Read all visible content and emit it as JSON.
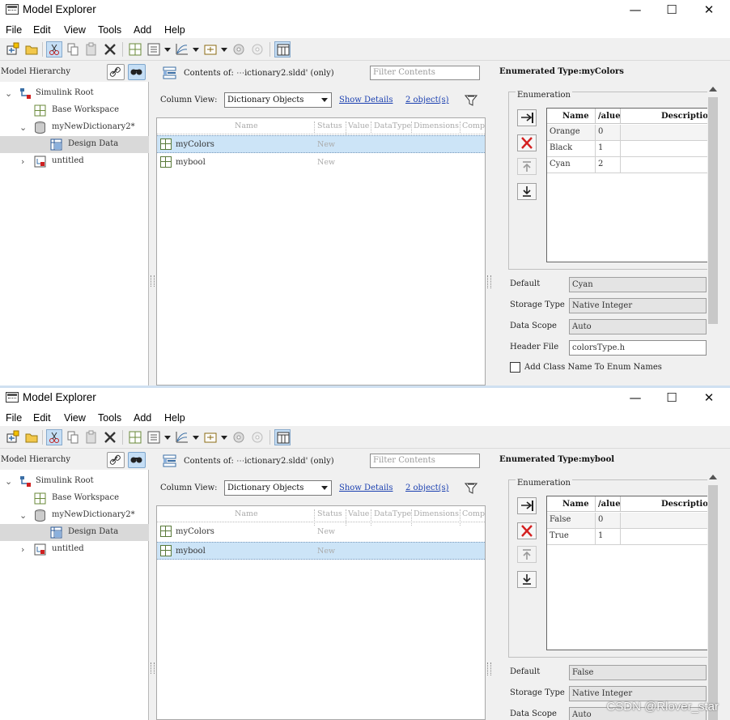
{
  "app": {
    "title": "Model Explorer",
    "window_buttons": {
      "minimize": "—",
      "maximize": "☐",
      "close": "✕"
    }
  },
  "menu": [
    "File",
    "Edit",
    "View",
    "Tools",
    "Add",
    "Help"
  ],
  "toolbar_icons": [
    "new-object-icon",
    "open-folder-icon",
    "cut-icon",
    "copy-icon",
    "paste-icon",
    "delete-icon",
    "show-grid-icon",
    "properties-icon",
    "plot-icon",
    "add-element-icon",
    "settings-gear-icon",
    "settings-disabled-icon",
    "dialog-view-icon"
  ],
  "left": {
    "header": "Model Hierarchy",
    "tree": [
      {
        "label": "Simulink Root"
      },
      {
        "label": "Base Workspace"
      },
      {
        "label": "myNewDictionary2*"
      },
      {
        "label": "Design Data"
      },
      {
        "label": "untitled"
      }
    ]
  },
  "middle": {
    "contents_label": "Contents of: ⋯ictionary2.sldd' (only)",
    "filter_placeholder": "Filter Contents",
    "column_view_label": "Column View:",
    "column_view_value": "Dictionary Objects",
    "show_details": "Show Details",
    "object_count": "2 object(s)",
    "columns": [
      "Name",
      "Status",
      "Value",
      "DataType",
      "Dimensions",
      "Compl"
    ],
    "rows": [
      {
        "name": "myColors",
        "status": "New"
      },
      {
        "name": "mybool",
        "status": "New"
      }
    ]
  },
  "windows": [
    {
      "selected_row": 0,
      "enum_title": "Enumerated Type:myColors",
      "enumeration_label": "Enumeration",
      "table_headers": [
        "Name",
        "/alue",
        "Descriptio"
      ],
      "enum_rows": [
        {
          "name": "Orange",
          "value": "0"
        },
        {
          "name": "Black",
          "value": "1"
        },
        {
          "name": "Cyan",
          "value": "2"
        }
      ],
      "default_label": "Default",
      "default_value": "Cyan",
      "storage_type_label": "Storage Type",
      "storage_type_value": "Native Integer",
      "data_scope_label": "Data Scope",
      "data_scope_value": "Auto",
      "header_file_label": "Header File",
      "header_file_value": "colorsType.h",
      "add_class_label": "Add Class Name To Enum Names"
    },
    {
      "selected_row": 1,
      "enum_title": "Enumerated Type:mybool",
      "enumeration_label": "Enumeration",
      "table_headers": [
        "Name",
        "/alue",
        "Descriptio"
      ],
      "enum_rows": [
        {
          "name": "False",
          "value": "0"
        },
        {
          "name": "True",
          "value": "1"
        }
      ],
      "default_label": "Default",
      "default_value": "False",
      "storage_type_label": "Storage Type",
      "storage_type_value": "Native Integer",
      "data_scope_label": "Data Scope",
      "data_scope_value": "Auto"
    }
  ],
  "watermark": "CSDN @Rlover_star",
  "colors": {
    "selection": "#cce4f7",
    "link": "#1a3fb0",
    "delete_red": "#d42020"
  }
}
